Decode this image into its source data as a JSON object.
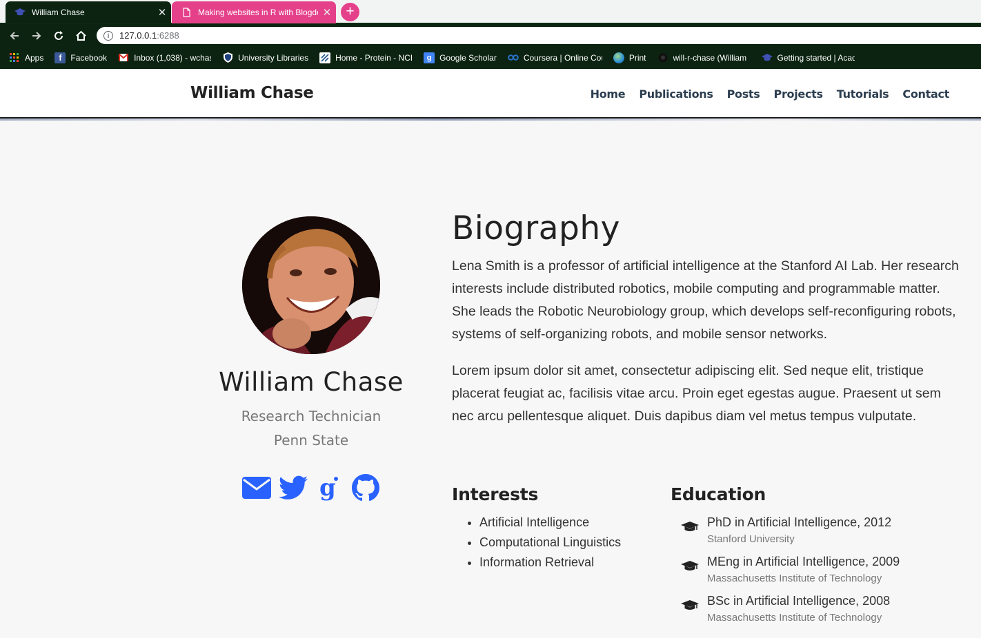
{
  "browser": {
    "tabs": [
      {
        "title": "William Chase",
        "icon": "graduation-cap-icon"
      },
      {
        "title": "Making websites in R with Blogdo",
        "icon": "document-icon"
      }
    ],
    "new_tab_label": "+",
    "url_host": "127.0.0.1",
    "url_port": ":6288",
    "bookmarks": [
      {
        "label": "Apps",
        "icon": "apps-grid-icon"
      },
      {
        "label": "Facebook",
        "icon": "facebook-icon"
      },
      {
        "label": "Inbox (1,038) - wchas",
        "icon": "gmail-icon"
      },
      {
        "label": "University Libraries",
        "icon": "shield-icon"
      },
      {
        "label": "Home - Protein - NCI",
        "icon": "ncbi-icon"
      },
      {
        "label": "Google Scholar",
        "icon": "google-scholar-icon"
      },
      {
        "label": "Coursera | Online Cou",
        "icon": "coursera-icon"
      },
      {
        "label": "Print",
        "icon": "globe-icon"
      },
      {
        "label": "will-r-chase (William",
        "icon": "github-icon"
      },
      {
        "label": "Getting started | Acad",
        "icon": "graduation-cap-icon"
      }
    ]
  },
  "site": {
    "brand": "William Chase",
    "nav": [
      "Home",
      "Publications",
      "Posts",
      "Projects",
      "Tutorials",
      "Contact"
    ]
  },
  "profile": {
    "name": "William Chase",
    "role": "Research Technician",
    "org": "Penn State",
    "social_icons": [
      "envelope-icon",
      "twitter-icon",
      "google-scholar-icon",
      "github-icon"
    ],
    "accent": "#2962ff"
  },
  "biography": {
    "title": "Biography",
    "paragraphs": [
      "Lena Smith is a professor of artificial intelligence at the Stanford AI Lab. Her research interests include distributed robotics, mobile computing and programmable matter. She leads the Robotic Neurobiology group, which develops self-reconfiguring robots, systems of self-organizing robots, and mobile sensor networks.",
      "Lorem ipsum dolor sit amet, consectetur adipiscing elit. Sed neque elit, tristique placerat feugiat ac, facilisis vitae arcu. Proin eget egestas augue. Praesent ut sem nec arcu pellentesque aliquet. Duis dapibus diam vel metus tempus vulputate."
    ]
  },
  "interests": {
    "title": "Interests",
    "items": [
      "Artificial Intelligence",
      "Computational Linguistics",
      "Information Retrieval"
    ]
  },
  "education": {
    "title": "Education",
    "items": [
      {
        "degree": "PhD in Artificial Intelligence, 2012",
        "institution": "Stanford University"
      },
      {
        "degree": "MEng in Artificial Intelligence, 2009",
        "institution": "Massachusetts Institute of Technology"
      },
      {
        "degree": "BSc in Artificial Intelligence, 2008",
        "institution": "Massachusetts Institute of Technology"
      }
    ]
  }
}
